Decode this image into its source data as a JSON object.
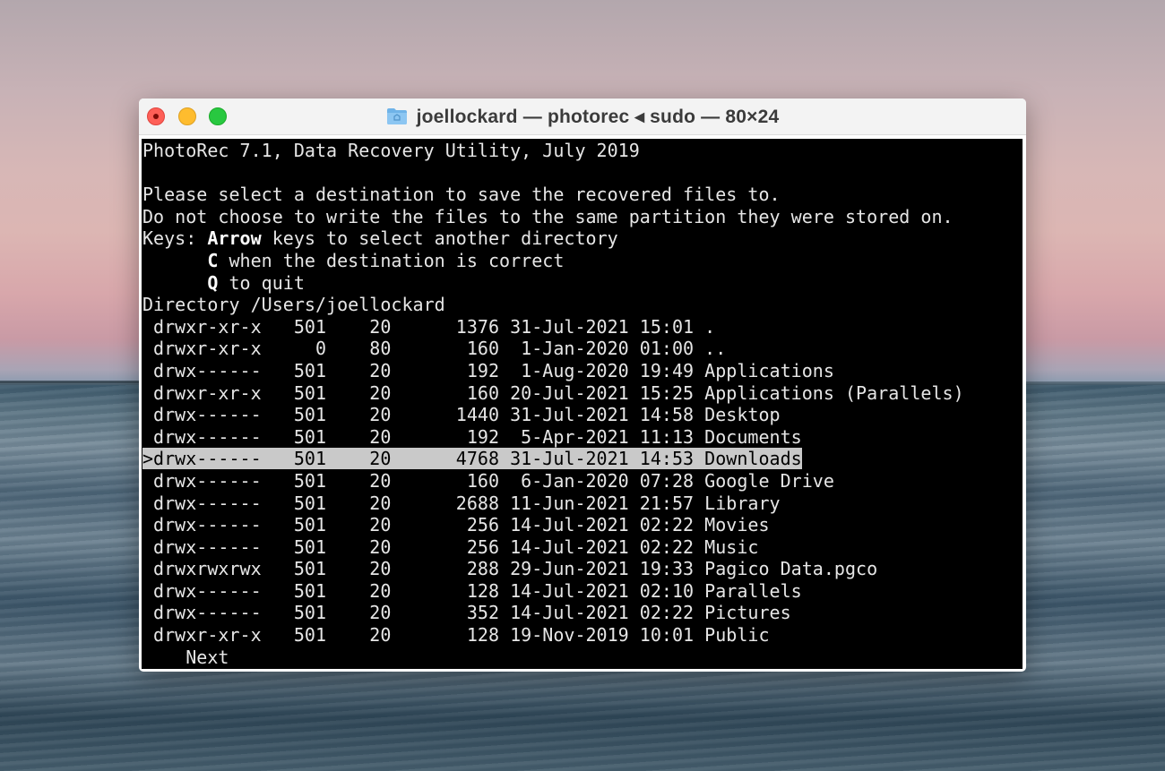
{
  "window": {
    "title": "joellockard — photorec ◂ sudo — 80×24"
  },
  "terminal": {
    "header": "PhotoRec 7.1, Data Recovery Utility, July 2019",
    "prompt_line1": "Please select a destination to save the recovered files to.",
    "prompt_line2": "Do not choose to write the files to the same partition they were stored on.",
    "keys_prefix": "Keys: ",
    "key_arrow": "Arrow",
    "key_arrow_desc": " keys to select another directory",
    "key_c_indent": "      ",
    "key_c": "C",
    "key_c_desc": " when the destination is correct",
    "key_q_indent": "      ",
    "key_q": "Q",
    "key_q_desc": " to quit",
    "directory_line": "Directory /Users/joellockard",
    "entries": [
      {
        "text": " drwxr-xr-x   501    20      1376 31-Jul-2021 15:01 ."
      },
      {
        "text": " drwxr-xr-x     0    80       160  1-Jan-2020 01:00 .."
      },
      {
        "text": " drwx------   501    20       192  1-Aug-2020 19:49 Applications"
      },
      {
        "text": " drwxr-xr-x   501    20       160 20-Jul-2021 15:25 Applications (Parallels)"
      },
      {
        "text": " drwx------   501    20      1440 31-Jul-2021 14:58 Desktop"
      },
      {
        "text": " drwx------   501    20       192  5-Apr-2021 11:13 Documents"
      },
      {
        "text": ">drwx------   501    20      4768 31-Jul-2021 14:53 Downloads",
        "selected": true
      },
      {
        "text": " drwx------   501    20       160  6-Jan-2020 07:28 Google Drive"
      },
      {
        "text": " drwx------   501    20      2688 11-Jun-2021 21:57 Library"
      },
      {
        "text": " drwx------   501    20       256 14-Jul-2021 02:22 Movies"
      },
      {
        "text": " drwx------   501    20       256 14-Jul-2021 02:22 Music"
      },
      {
        "text": " drwxrwxrwx   501    20       288 29-Jun-2021 19:33 Pagico Data.pgco"
      },
      {
        "text": " drwx------   501    20       128 14-Jul-2021 02:10 Parallels"
      },
      {
        "text": " drwx------   501    20       352 14-Jul-2021 02:22 Pictures"
      },
      {
        "text": " drwxr-xr-x   501    20       128 19-Nov-2019 10:01 Public"
      }
    ],
    "next": "    Next"
  }
}
